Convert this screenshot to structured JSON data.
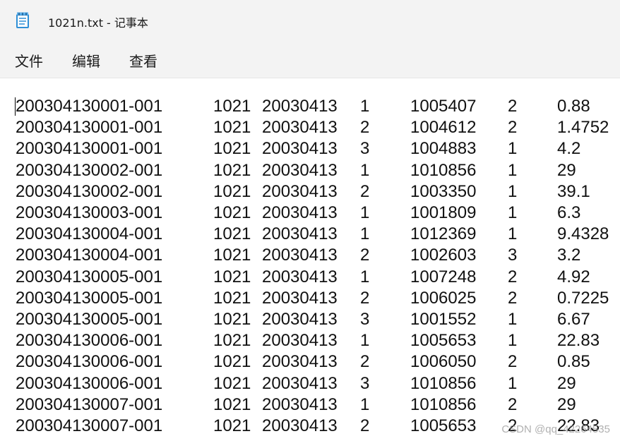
{
  "window": {
    "title": "1021n.txt - 记事本"
  },
  "menu": {
    "items": [
      "文件",
      "编辑",
      "查看"
    ]
  },
  "icons": {
    "app": "notepad-icon"
  },
  "editor": {
    "rows": [
      [
        "200304130001-001",
        "1021",
        "20030413",
        "1",
        "1005407",
        "2",
        "0.88"
      ],
      [
        "200304130001-001",
        "1021",
        "20030413",
        "2",
        "1004612",
        "2",
        "1.4752"
      ],
      [
        "200304130001-001",
        "1021",
        "20030413",
        "3",
        "1004883",
        "1",
        "4.2"
      ],
      [
        "200304130002-001",
        "1021",
        "20030413",
        "1",
        "1010856",
        "1",
        "29"
      ],
      [
        "200304130002-001",
        "1021",
        "20030413",
        "2",
        "1003350",
        "1",
        "39.1"
      ],
      [
        "200304130003-001",
        "1021",
        "20030413",
        "1",
        "1001809",
        "1",
        "6.3"
      ],
      [
        "200304130004-001",
        "1021",
        "20030413",
        "1",
        "1012369",
        "1",
        "9.4328"
      ],
      [
        "200304130004-001",
        "1021",
        "20030413",
        "2",
        "1002603",
        "3",
        "3.2"
      ],
      [
        "200304130005-001",
        "1021",
        "20030413",
        "1",
        "1007248",
        "2",
        "4.92"
      ],
      [
        "200304130005-001",
        "1021",
        "20030413",
        "2",
        "1006025",
        "2",
        "0.7225"
      ],
      [
        "200304130005-001",
        "1021",
        "20030413",
        "3",
        "1001552",
        "1",
        "6.67"
      ],
      [
        "200304130006-001",
        "1021",
        "20030413",
        "1",
        "1005653",
        "1",
        "22.83"
      ],
      [
        "200304130006-001",
        "1021",
        "20030413",
        "2",
        "1006050",
        "2",
        "0.85"
      ],
      [
        "200304130006-001",
        "1021",
        "20030413",
        "3",
        "1010856",
        "1",
        "29"
      ],
      [
        "200304130007-001",
        "1021",
        "20030413",
        "1",
        "1010856",
        "2",
        "29"
      ],
      [
        "200304130007-001",
        "1021",
        "20030413",
        "2",
        "1005653",
        "2",
        "22.83"
      ]
    ]
  },
  "watermark": "CSDN @qq_42264535"
}
